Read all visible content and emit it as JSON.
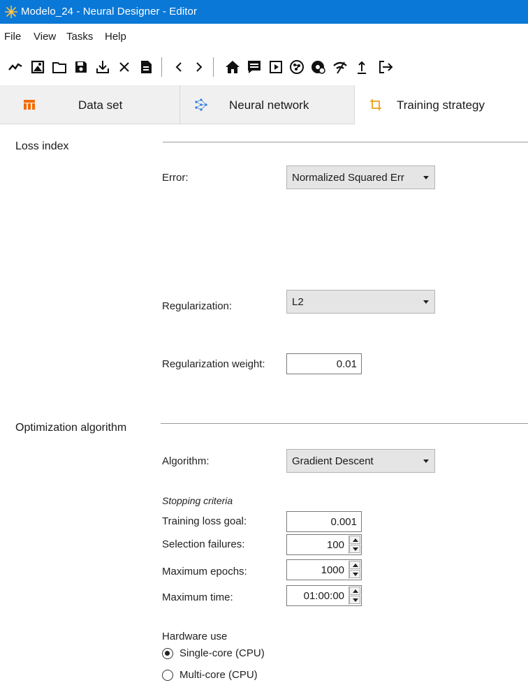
{
  "window": {
    "title": "Modelo_24 - Neural Designer - Editor"
  },
  "menu": [
    "File",
    "View",
    "Tasks",
    "Help"
  ],
  "toolbar_icons": [
    "line-chart-icon",
    "image-icon",
    "folder-icon",
    "save-icon",
    "download-icon",
    "close-icon",
    "document-icon",
    "chevron-left-icon",
    "chevron-right-icon",
    "home-icon",
    "comment-icon",
    "play-icon",
    "brain-icon",
    "brain-settings-icon",
    "wifi-off-icon",
    "upload-icon",
    "export-icon"
  ],
  "tabs": [
    {
      "label": "Data set",
      "icon": "table-icon",
      "color": "#f26b00"
    },
    {
      "label": "Neural network",
      "icon": "network-icon",
      "color": "#2f7bd8"
    },
    {
      "label": "Training strategy",
      "icon": "crop-icon",
      "color": "#e8a21c"
    }
  ],
  "loss_index": {
    "title": "Loss index",
    "error_label": "Error:",
    "error_value": "Normalized Squared Err",
    "regularization_label": "Regularization:",
    "regularization_value": "L2",
    "weight_label": "Regularization weight:",
    "weight_value": "0.01"
  },
  "optimization": {
    "title": "Optimization algorithm",
    "algorithm_label": "Algorithm:",
    "algorithm_value": "Gradient Descent",
    "stopping_title": "Stopping criteria",
    "loss_goal_label": "Training loss goal:",
    "loss_goal_value": "0.001",
    "selection_failures_label": "Selection failures:",
    "selection_failures_value": "100",
    "max_epochs_label": "Maximum epochs:",
    "max_epochs_value": "1000",
    "max_time_label": "Maximum time:",
    "max_time_value": "01:00:00"
  },
  "hardware": {
    "title": "Hardware use",
    "options": [
      "Single-core (CPU)",
      "Multi-core (CPU)"
    ],
    "selected": "Single-core (CPU)"
  }
}
